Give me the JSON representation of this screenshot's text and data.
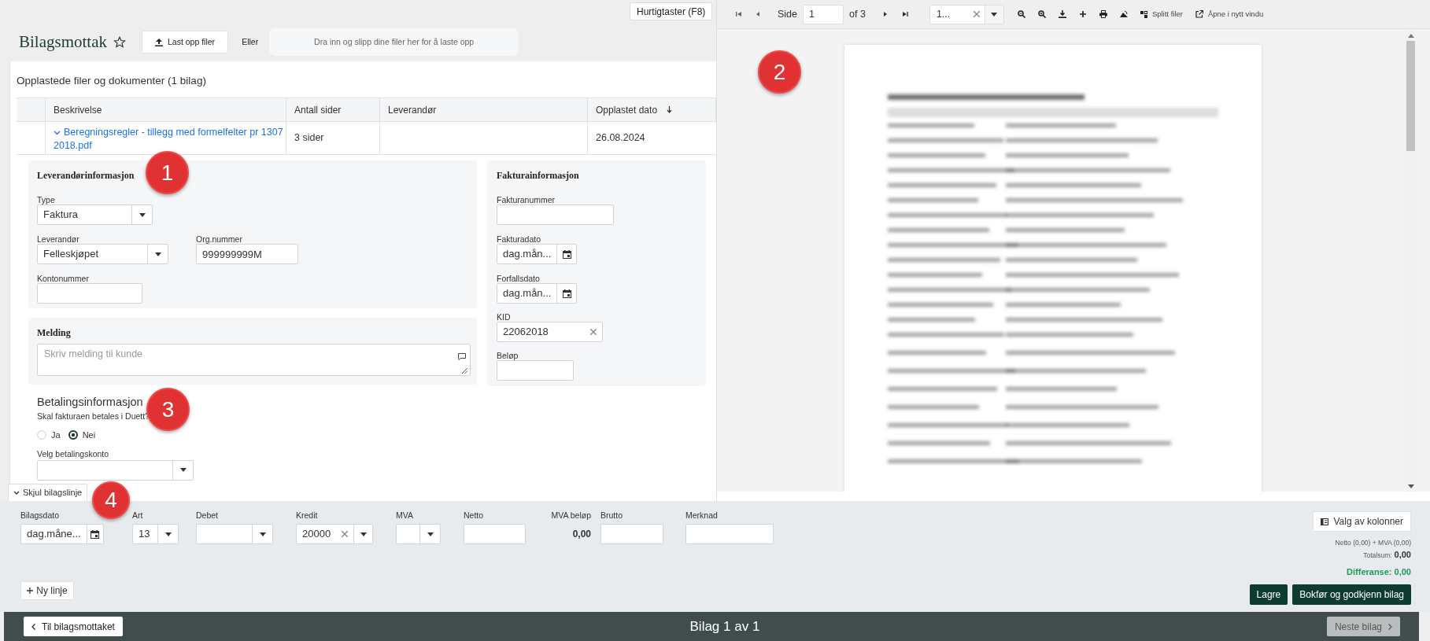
{
  "header": {
    "title": "Bilagsmottak",
    "favorite": false,
    "upload_button": "Last opp filer",
    "or_label": "Eller",
    "dropzone": "Dra inn og slipp dine filer her for å laste opp",
    "shortcuts_button": "Hurtigtaster (F8)"
  },
  "files": {
    "heading": "Opplastede filer og dokumenter (1 bilag)",
    "columns": [
      {
        "label": "Beskrivelse",
        "sorted": false
      },
      {
        "label": "Antall sider",
        "sorted": false
      },
      {
        "label": "Leverandør",
        "sorted": false
      },
      {
        "label": "Opplastet dato",
        "sorted": true
      }
    ],
    "rows": [
      {
        "description": "Beregningsregler - tillegg med formelfelter pr 13072018.pdf",
        "pages": "3 sider",
        "date": "26.08.2024",
        "expanded": true
      }
    ]
  },
  "supplier": {
    "heading": "Leverandørinformasjon",
    "type_label": "Type",
    "type_value": "Faktura",
    "supplier_label": "Leverandør",
    "supplier_value": "Felleskjøpet",
    "org_label": "Org.nummer",
    "org_value": "999999999M",
    "account_label": "Kontonummer"
  },
  "message": {
    "heading": "Melding",
    "placeholder": "Skriv melding til kunde"
  },
  "invoice": {
    "heading": "Fakturainformasjon",
    "number_label": "Fakturanummer",
    "date_label": "Fakturadato",
    "date_placeholder": "dag.mån...",
    "due_label": "Forfallsdato",
    "due_placeholder": "dag.mån...",
    "kid_label": "KID",
    "kid_value": "22062018",
    "amount_label": "Beløp"
  },
  "payment": {
    "heading": "Betalingsinformasjon",
    "question": "Skal fakturaen betales i Duett?",
    "options": [
      {
        "label": "Ja",
        "selected": false
      },
      {
        "label": "Nei",
        "selected": true
      }
    ],
    "account_label": "Velg betalingskonto"
  },
  "callouts": [
    "1",
    "2",
    "3",
    "4"
  ],
  "viewer": {
    "page_label": "Side",
    "page_value": "1",
    "page_total": "of 3",
    "zoom_value": "1...",
    "split_button": "Splitt filer",
    "open_button": "Åpne i nytt vindu"
  },
  "line": {
    "toggle": "Skjul bilagslinje",
    "expanded": true,
    "date_label": "Bilagsdato",
    "date_placeholder": "dag.måne...",
    "art_label": "Art",
    "art_value": "13",
    "debet_label": "Debet",
    "kredit_label": "Kredit",
    "kredit_value": "20000",
    "mva_label": "MVA",
    "netto_label": "Netto",
    "mva_amount_label": "MVA beløp",
    "mva_amount": "0,00",
    "brutto_label": "Brutto",
    "note_label": "Merknad",
    "columns_button": "Valg av kolonner",
    "sum_line": "Netto (0,00) + MVA (0,00)",
    "total_label": "Totalsum:",
    "total": "0,00",
    "difference": "Differanse: 0,00",
    "new_line_button": "Ny linje",
    "save_button": "Lagre",
    "post_button": "Bokfør og godkjenn bilag"
  },
  "footer": {
    "back_button": "Til bilagsmottaket",
    "position": "Bilag 1 av 1",
    "next_button": "Neste bilag",
    "next_disabled": true
  }
}
